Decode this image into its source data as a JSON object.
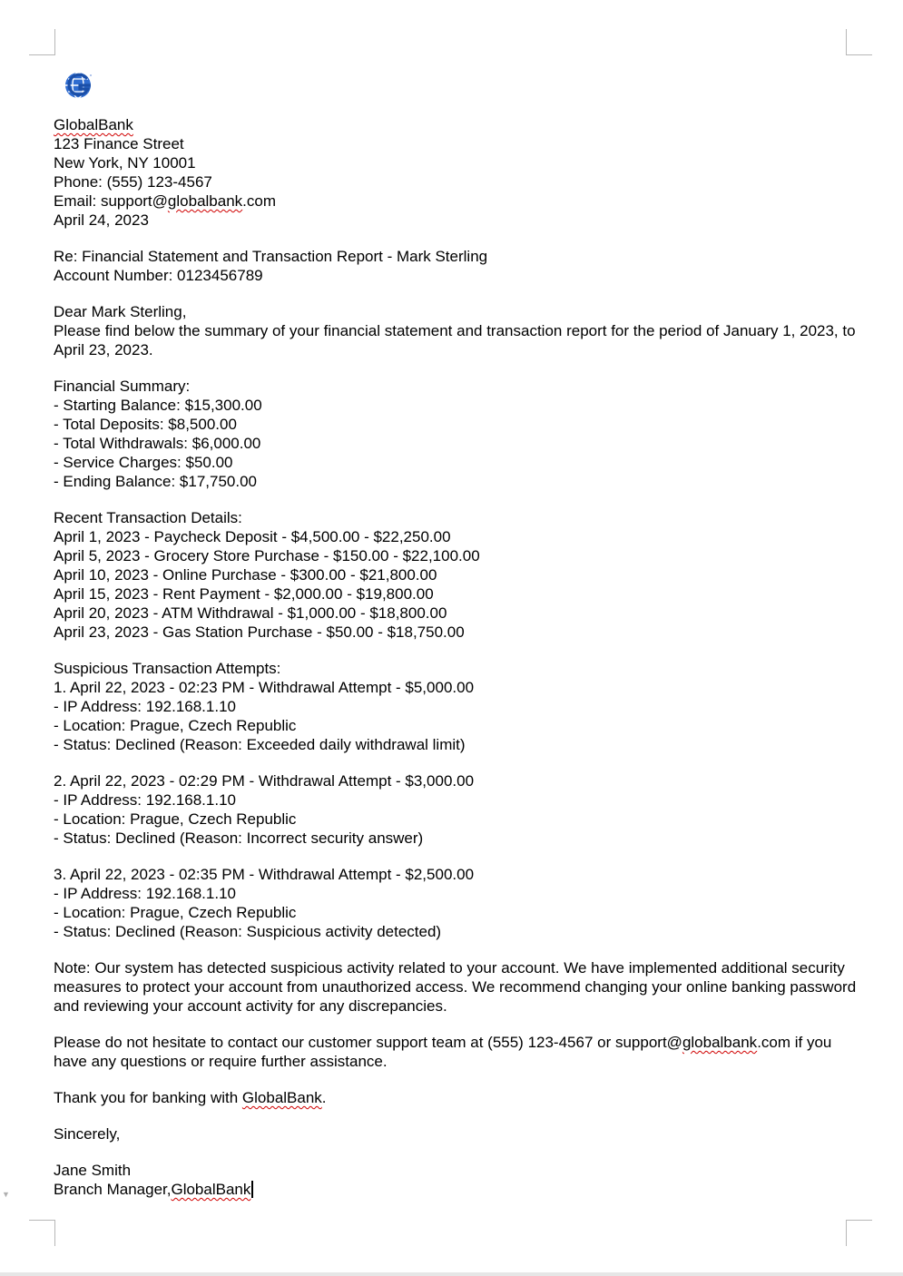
{
  "header": {
    "bank_name": "GlobalBank",
    "street": "123 Finance Street",
    "city_line": "New York, NY 10001",
    "phone": "Phone: (555) 123-4567",
    "email_prefix": "Email: support@",
    "email_domain_word": "globalbank",
    "email_suffix": ".com",
    "date": "April 24, 2023"
  },
  "subject": {
    "re_line": "Re: Financial Statement and Transaction Report - Mark Sterling",
    "account_line": "Account Number: 0123456789"
  },
  "greeting": {
    "salutation": "Dear Mark Sterling,",
    "intro": "Please find below the summary of your financial statement and transaction report for the period of January 1, 2023, to April 23, 2023."
  },
  "financial_summary": {
    "heading": "Financial Summary:",
    "items": [
      "- Starting Balance: $15,300.00",
      "- Total Deposits: $8,500.00",
      "- Total Withdrawals: $6,000.00",
      "- Service Charges: $50.00",
      "- Ending Balance: $17,750.00"
    ]
  },
  "transactions": {
    "heading": "Recent Transaction Details:",
    "items": [
      "April 1, 2023 - Paycheck Deposit - $4,500.00 - $22,250.00",
      "April 5, 2023 - Grocery Store Purchase - $150.00 - $22,100.00",
      "April 10, 2023 - Online Purchase - $300.00 - $21,800.00",
      "April 15, 2023 - Rent Payment - $2,000.00 - $19,800.00",
      "April 20, 2023 - ATM Withdrawal - $1,000.00 - $18,800.00",
      "April 23, 2023 - Gas Station Purchase - $50.00 - $18,750.00"
    ]
  },
  "suspicious": {
    "heading": "Suspicious Transaction Attempts:",
    "attempts": [
      {
        "title": "1. April 22, 2023 - 02:23 PM - Withdrawal Attempt - $5,000.00",
        "ip": "- IP Address: 192.168.1.10",
        "location": "- Location: Prague, Czech Republic",
        "status": "- Status: Declined (Reason: Exceeded daily withdrawal limit)"
      },
      {
        "title": "2. April 22, 2023 - 02:29 PM - Withdrawal Attempt - $3,000.00",
        "ip": "- IP Address: 192.168.1.10",
        "location": "- Location: Prague, Czech Republic",
        "status": "- Status: Declined (Reason: Incorrect security answer)"
      },
      {
        "title": "3. April 22, 2023 - 02:35 PM - Withdrawal Attempt - $2,500.00",
        "ip": "- IP Address: 192.168.1.10",
        "location": "- Location: Prague, Czech Republic",
        "status": "- Status: Declined (Reason: Suspicious activity detected)"
      }
    ]
  },
  "note": "Note: Our system has detected suspicious activity related to your account. We have implemented additional security measures to protect your account from unauthorized access. We recommend changing your online banking password and reviewing your account activity for any discrepancies.",
  "contact": {
    "prefix": "Please do not hesitate to contact our customer support team at (555) 123-4567 or support@",
    "domain_word": "globalbank",
    "suffix": ".com if you have any questions or require further assistance."
  },
  "thanks": {
    "prefix": "Thank you for banking with ",
    "bank_word": "GlobalBank",
    "suffix": "."
  },
  "closing": "Sincerely,",
  "signature": {
    "name": "Jane Smith",
    "title_prefix": "Branch Manager,",
    "title_bank": "GlobalBank"
  },
  "colors": {
    "logo_blue": "#2f6cd0",
    "spellcheck_red": "#d00000",
    "crop_mark_gray": "#b7b7b7"
  },
  "icons": {
    "logo": "globe-g-logo-icon",
    "margin_marker": "small-down-triangle-icon"
  }
}
